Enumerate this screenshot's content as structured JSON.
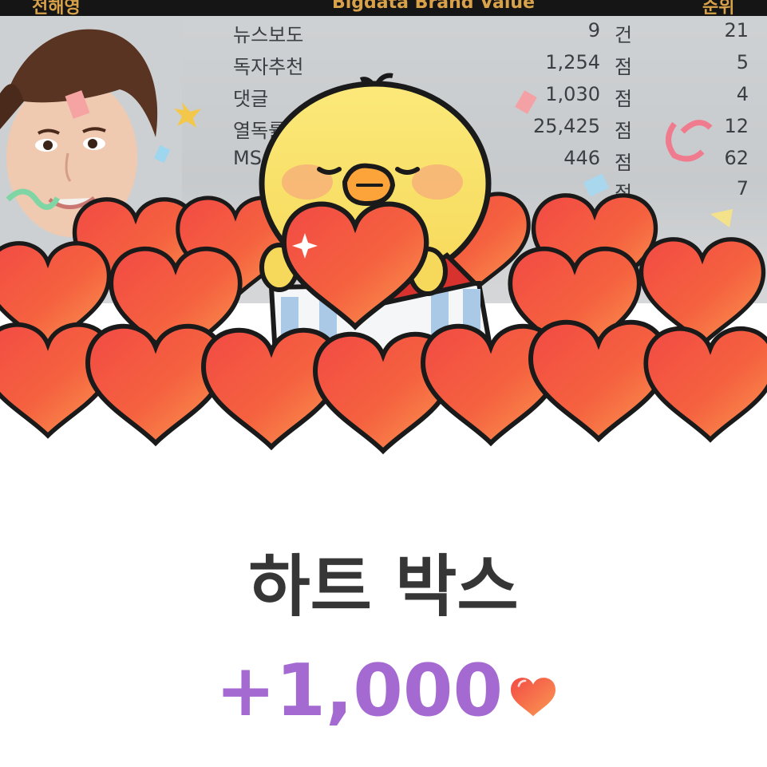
{
  "background_panel": {
    "header": {
      "left": "전해영",
      "center": "Bigdata Brand Value",
      "right": "순위"
    },
    "rows": [
      {
        "label": "뉴스보도",
        "value": "9",
        "unit": "건",
        "rank": "21"
      },
      {
        "label": "독자추천",
        "value": "1,254",
        "unit": "점",
        "rank": "5"
      },
      {
        "label": "댓글",
        "value": "1,030",
        "unit": "점",
        "rank": "4"
      },
      {
        "label": "열독률",
        "value": "25,425",
        "unit": "점",
        "rank": "12"
      },
      {
        "label": "MS",
        "value": "446",
        "unit": "점",
        "rank": "62"
      },
      {
        "label": "",
        "value": "",
        "unit": "점",
        "rank": "7"
      }
    ]
  },
  "reward": {
    "title": "하트 박스",
    "amount": "+1,000",
    "icon": "heart-icon"
  },
  "colors": {
    "amount": "#a56ad2",
    "title": "#363636",
    "heart": "#f0643f",
    "header_text": "#d8a24a"
  }
}
